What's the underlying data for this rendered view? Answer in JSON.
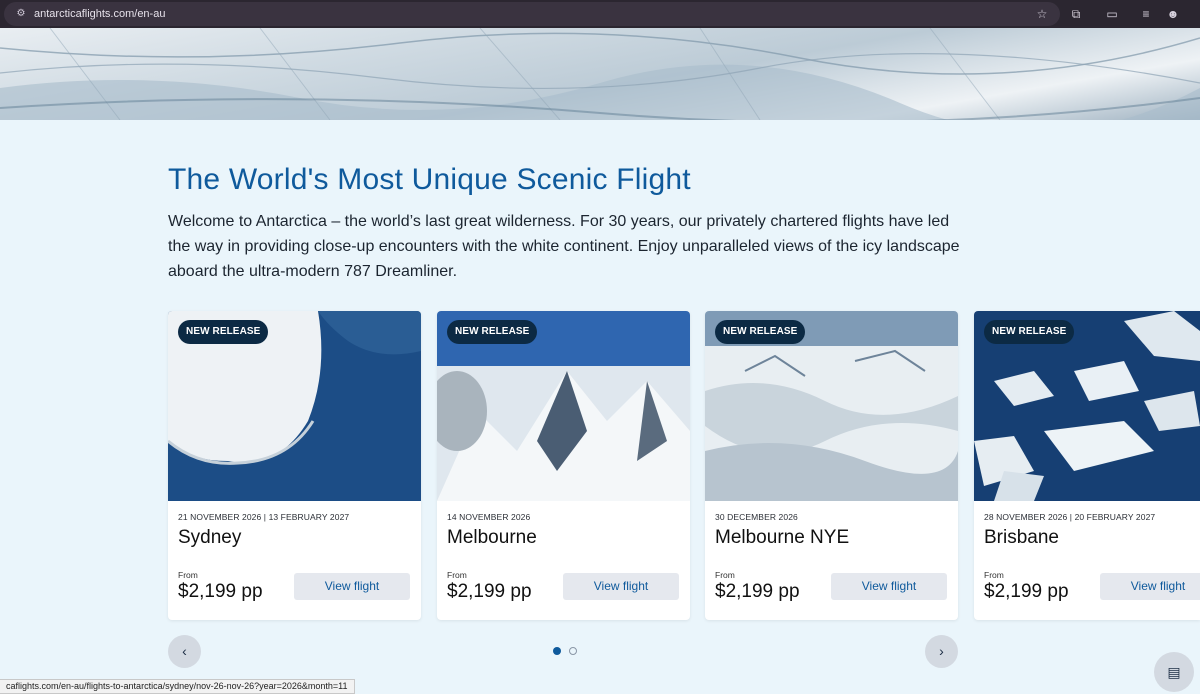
{
  "browser": {
    "url": "antarcticaflights.com/en-au",
    "icons": [
      "site-info-icon",
      "bookmark-star-icon",
      "extensions-icon",
      "media-cast-icon",
      "reading-list-icon",
      "profile-avatar-icon"
    ]
  },
  "main": {
    "title": "The World's Most Unique Scenic Flight",
    "intro": "Welcome to Antarctica – the world’s last great wilderness. For 30 years, our privately chartered flights have led the way in providing close-up encounters with the white continent. Enjoy unparalleled views of the icy landscape aboard the ultra-modern 787 Dreamliner."
  },
  "cards": [
    {
      "badge": "NEW RELEASE",
      "dates": "21 NOVEMBER 2026 | 13 FEBRUARY 2027",
      "city": "Sydney",
      "from_label": "From",
      "price": "$2,199 pp",
      "button": "View flight"
    },
    {
      "badge": "NEW RELEASE",
      "dates": "14 NOVEMBER 2026",
      "city": "Melbourne",
      "from_label": "From",
      "price": "$2,199 pp",
      "button": "View flight"
    },
    {
      "badge": "NEW RELEASE",
      "dates": "30 DECEMBER 2026",
      "city": "Melbourne NYE",
      "from_label": "From",
      "price": "$2,199 pp",
      "button": "View flight"
    },
    {
      "badge": "NEW RELEASE",
      "dates": "28 NOVEMBER 2026 | 20 FEBRUARY 2027",
      "city": "Brisbane",
      "from_label": "From",
      "price": "$2,199 pp",
      "button": "View flight"
    }
  ],
  "carousel": {
    "prev_icon": "chevron-left-icon",
    "next_icon": "chevron-right-icon",
    "dots": 2,
    "active_dot": 1
  },
  "status_bar": {
    "link": "caflights.com/en-au/flights-to-antarctica/sydney/nov-26-nov-26?year=2026&month=11"
  },
  "colors": {
    "accent": "#0f5a9c",
    "badge": "#0c2a44",
    "page_bg": "#eaf5fb"
  }
}
